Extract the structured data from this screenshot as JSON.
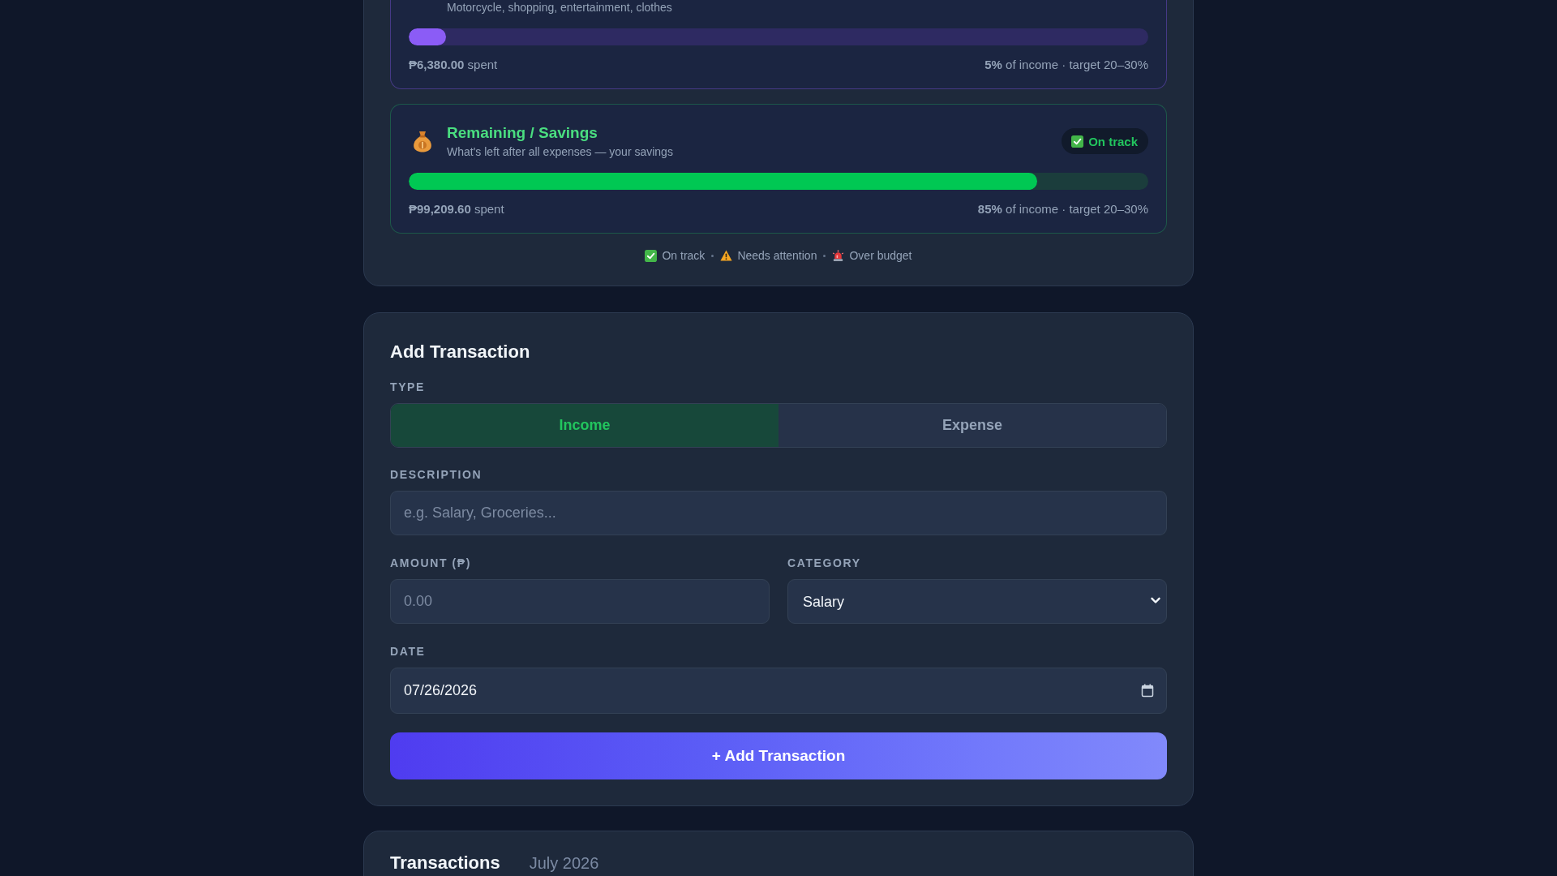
{
  "budget": {
    "categories": [
      {
        "kind": "wants",
        "subtitle": "Motorcycle, shopping, entertainment, clothes",
        "level": 0.05,
        "spent": "**₱6,380.00** spent",
        "share": "**5%** of income · target 20–30%"
      },
      {
        "kind": "savings",
        "title": "Remaining / Savings",
        "subtitle": "What's left after all expenses — your savings",
        "badge": {
          "kind": "on_track",
          "label": "On track"
        },
        "level": 0.85,
        "spent": "**₱99,209.60** spent",
        "share": "**85%** of income · target 20–30%"
      }
    ],
    "legend": [
      {
        "kind": "on_track",
        "label": "On track"
      },
      {
        "kind": "needs_attention",
        "label": "Needs attention"
      },
      {
        "kind": "over_budget",
        "label": "Over budget"
      }
    ]
  },
  "add_transaction": {
    "title": "Add Transaction",
    "type": {
      "label": "TYPE",
      "options": [
        {
          "kind": "income",
          "label": "Income",
          "selected": true
        },
        {
          "kind": "expense",
          "label": "Expense",
          "selected": false
        }
      ]
    },
    "description": {
      "label": "DESCRIPTION",
      "placeholder": "e.g. Salary, Groceries..."
    },
    "amount": {
      "label": "AMOUNT (₱)",
      "placeholder": "0.00"
    },
    "category": {
      "label": "CATEGORY",
      "value": "Salary"
    },
    "date": {
      "label": "DATE",
      "value": "07/26/2026"
    },
    "submit": "+ Add Transaction"
  },
  "transactions": {
    "title": "Transactions",
    "period": "July 2026"
  }
}
